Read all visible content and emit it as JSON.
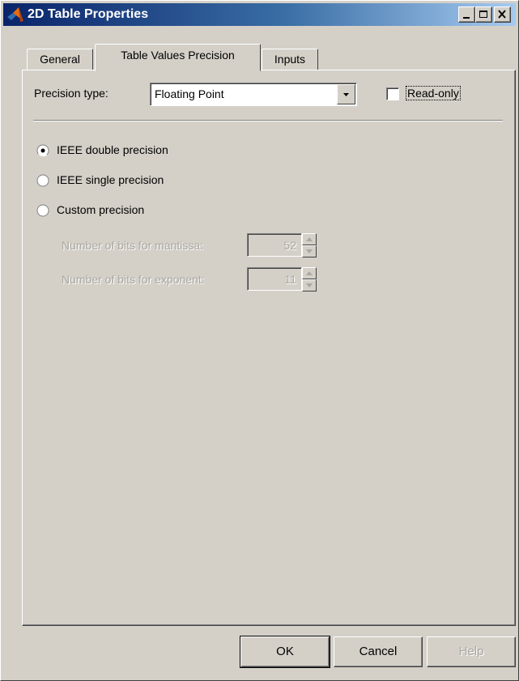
{
  "window": {
    "title": "2D Table Properties",
    "colors": {
      "titlebar_start": "#0a246a",
      "titlebar_end": "#a6caf0",
      "face": "#d4d0c8",
      "disabled_text": "#a9a7a0"
    }
  },
  "tabs": [
    {
      "label": "General",
      "active": false
    },
    {
      "label": "Table Values Precision",
      "active": true
    },
    {
      "label": "Inputs",
      "active": false
    }
  ],
  "precision": {
    "type_label": "Precision type:",
    "type_value": "Floating Point",
    "readonly_label": "Read-only",
    "readonly_checked": false
  },
  "radios": [
    {
      "label": "IEEE double precision",
      "selected": true
    },
    {
      "label": "IEEE single precision",
      "selected": false
    },
    {
      "label": "Custom precision",
      "selected": false
    }
  ],
  "custom": {
    "mantissa_label": "Number of bits for mantissa:",
    "mantissa_value": "52",
    "exponent_label": "Number of bits for exponent:",
    "exponent_value": "11"
  },
  "buttons": {
    "ok": "OK",
    "cancel": "Cancel",
    "help": "Help"
  },
  "icons": [
    "matlab-logo-icon",
    "minimize-icon",
    "maximize-icon",
    "close-icon",
    "chevron-down-icon",
    "spinner-up-icon",
    "spinner-down-icon"
  ]
}
